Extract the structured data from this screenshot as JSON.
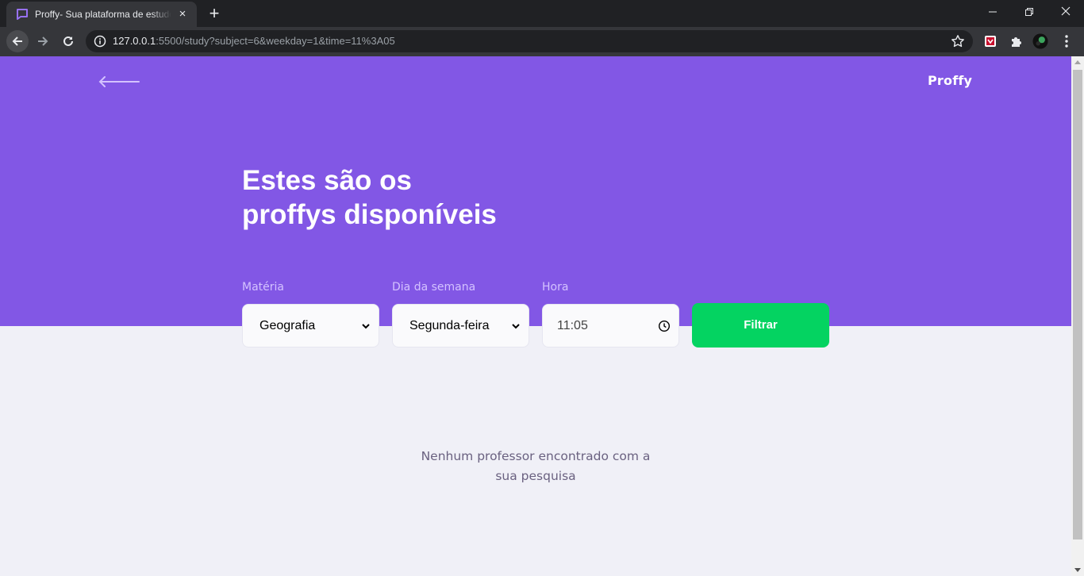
{
  "browser": {
    "tab_title": "Proffy- Sua plataforma de estudos online",
    "url_host": "127.0.0.1",
    "url_rest": ":5500/study?subject=6&weekday=1&time=11%3A05",
    "new_tab": "+",
    "close_tab": "×"
  },
  "header": {
    "logo": "Proffy"
  },
  "hero": {
    "title_line1": "Estes são os",
    "title_line2": "proffys disponíveis"
  },
  "filters": {
    "subject_label": "Matéria",
    "subject_value": "Geografia",
    "weekday_label": "Dia da semana",
    "weekday_value": "Segunda-feira",
    "time_label": "Hora",
    "time_value": "11:05",
    "submit_label": "Filtrar"
  },
  "results": {
    "empty_line1": "Nenhum professor encontrado com a",
    "empty_line2": "sua pesquisa"
  },
  "colors": {
    "primary": "#8257e5",
    "secondary": "#04d361",
    "background": "#f0f0f7"
  }
}
